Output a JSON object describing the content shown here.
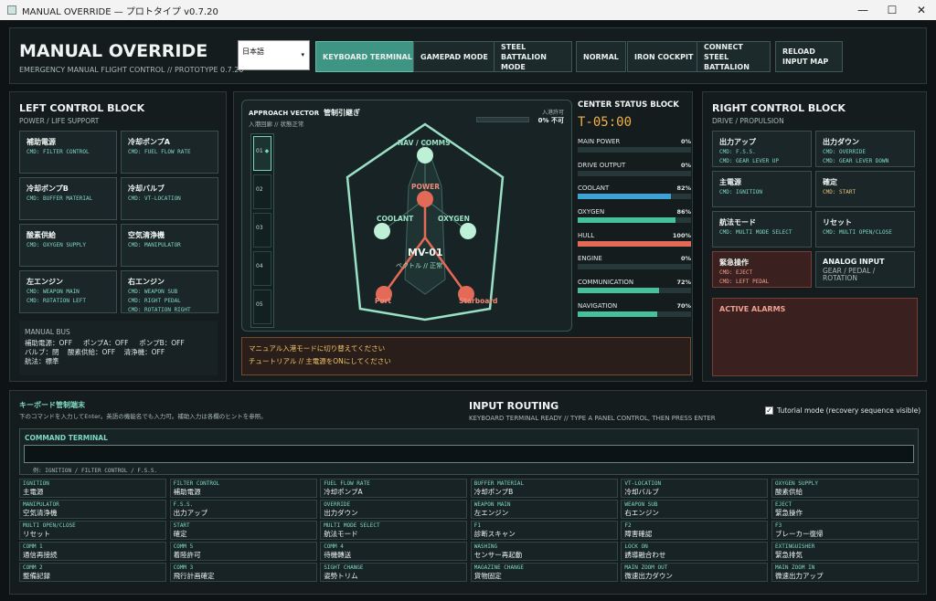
{
  "window": {
    "title": "MANUAL OVERRIDE — プロトタイプ v0.7.20",
    "minimize": "—",
    "maximize": "☐",
    "close": "✕"
  },
  "header": {
    "title": "MANUAL OVERRIDE",
    "subtitle": "EMERGENCY MANUAL FLIGHT CONTROL // PROTOTYPE 0.7.20",
    "language": "日本語",
    "modes": [
      "KEYBOARD TERMINAL",
      "GAMEPAD MODE",
      "STEEL BATTALION MODE",
      "NORMAL",
      "IRON COCKPIT",
      "CONNECT STEEL BATTALION",
      "RELOAD INPUT MAP"
    ],
    "active_mode": "KEYBOARD TERMINAL"
  },
  "left": {
    "title": "LEFT CONTROL BLOCK",
    "subtitle": "POWER / LIFE SUPPORT",
    "controls": [
      {
        "name": "補助電源",
        "cmd": [
          "CMD: FILTER CONTROL"
        ]
      },
      {
        "name": "冷却ポンプA",
        "cmd": [
          "CMD: FUEL FLOW RATE"
        ]
      },
      {
        "name": "冷却ポンプB",
        "cmd": [
          "CMD: BUFFER MATERIAL"
        ]
      },
      {
        "name": "冷却バルブ",
        "cmd": [
          "CMD: VT-LOCATION"
        ]
      },
      {
        "name": "酸素供給",
        "cmd": [
          "CMD: OXYGEN SUPPLY"
        ]
      },
      {
        "name": "空気清浄機",
        "cmd": [
          "CMD: MANIPULATOR"
        ]
      },
      {
        "name": "左エンジン",
        "cmd": [
          "CMD: WEAPON MAIN",
          "CMD: ROTATION LEFT"
        ]
      },
      {
        "name": "右エンジン",
        "cmd": [
          "CMD: WEAPON SUB",
          "CMD: RIGHT PEDAL",
          "CMD: ROTATION RIGHT"
        ]
      }
    ],
    "bus": {
      "title": "MANUAL BUS",
      "lines": [
        "補助電源：OFF     ポンプA：OFF     ポンプB：OFF",
        "バルブ：閉    酸素供給：OFF    清浄機：OFF",
        "航法：標準"
      ]
    }
  },
  "center": {
    "vector_title": "APPROACH VECTOR",
    "vector_title_jp": "管制引継ぎ",
    "vector_status": "入港回廊 // 状態正常",
    "permission_label": "入港許可",
    "permission_value": "0% 不可",
    "permission": 0,
    "slots": [
      "01",
      "02",
      "03",
      "04",
      "05"
    ],
    "nodes": {
      "nav": "NAV / COMMS",
      "power": "POWER",
      "coolant": "COOLANT",
      "oxygen": "OXYGEN",
      "port": "Port",
      "starboard": "Starboard"
    },
    "ship_id": "MV-01",
    "ship_state": "ベクトル // 正常",
    "messages": [
      "マニュアル入港モードに切り替えてください",
      "チュートリアル // 主電源をONにしてください"
    ]
  },
  "status": {
    "title": "CENTER STATUS BLOCK",
    "timer": "T-05:00",
    "rows": [
      {
        "label": "MAIN POWER",
        "value": "0%",
        "pct": 0,
        "color": "#46c29a"
      },
      {
        "label": "DRIVE OUTPUT",
        "value": "0%",
        "pct": 0,
        "color": "#46c29a"
      },
      {
        "label": "COOLANT",
        "value": "82%",
        "pct": 82,
        "color": "#3fa2d6"
      },
      {
        "label": "OXYGEN",
        "value": "86%",
        "pct": 86,
        "color": "#46c29a"
      },
      {
        "label": "HULL",
        "value": "100%",
        "pct": 100,
        "color": "#e46a58"
      },
      {
        "label": "ENGINE",
        "value": "0%",
        "pct": 0,
        "color": "#46c29a"
      },
      {
        "label": "COMMUNICATION",
        "value": "72%",
        "pct": 72,
        "color": "#46c29a"
      },
      {
        "label": "NAVIGATION",
        "value": "70%",
        "pct": 70,
        "color": "#46c29a"
      }
    ]
  },
  "right": {
    "title": "RIGHT CONTROL BLOCK",
    "subtitle": "DRIVE / PROPULSION",
    "controls": [
      {
        "name": "出力アップ",
        "cmd": [
          "CMD: F.S.S.",
          "CMD: GEAR LEVER UP"
        ]
      },
      {
        "name": "出力ダウン",
        "cmd": [
          "CMD: OVERRIDE",
          "CMD: GEAR LEVER DOWN"
        ]
      },
      {
        "name": "主電源",
        "cmd": [
          "CMD: IGNITION"
        ]
      },
      {
        "name": "確定",
        "cmd": [
          "CMD: START"
        ]
      },
      {
        "name": "航法モード",
        "cmd": [
          "CMD: MULTI MODE SELECT"
        ]
      },
      {
        "name": "リセット",
        "cmd": [
          "CMD: MULTI OPEN/CLOSE"
        ]
      },
      {
        "name": "緊急操作",
        "cmd": [
          "CMD: EJECT",
          "CMD: LEFT PEDAL"
        ]
      },
      {
        "name": "ANALOG INPUT",
        "cmd": [
          "GEAR / PEDAL / ROTATION"
        ]
      }
    ],
    "alarms": "ACTIVE ALARMS"
  },
  "bottom": {
    "kb_title": "キーボード管制端末",
    "kb_desc": "下のコマンドを入力してEnter。英語の機能名でも入力可。補助入力は各欄のヒントを参照。",
    "routing_title": "INPUT ROUTING",
    "routing_sub": "KEYBOARD TERMINAL READY // TYPE A PANEL CONTROL, THEN PRESS ENTER",
    "tutorial_label": "Tutorial mode (recovery sequence visible)",
    "tutorial_checked": true,
    "terminal_title": "COMMAND TERMINAL",
    "terminal_value": "",
    "terminal_example": "例: IGNITION / FILTER CONTROL / F.S.S.",
    "commands": [
      {
        "c": "IGNITION",
        "j": "主電源"
      },
      {
        "c": "FILTER CONTROL",
        "j": "補助電源"
      },
      {
        "c": "FUEL FLOW RATE",
        "j": "冷却ポンプA"
      },
      {
        "c": "BUFFER MATERIAL",
        "j": "冷却ポンプB"
      },
      {
        "c": "VT-LOCATION",
        "j": "冷却バルブ"
      },
      {
        "c": "OXYGEN SUPPLY",
        "j": "酸素供給"
      },
      {
        "c": "MANIPULATOR",
        "j": "空気清浄機"
      },
      {
        "c": "F.S.S.",
        "j": "出力アップ"
      },
      {
        "c": "OVERRIDE",
        "j": "出力ダウン"
      },
      {
        "c": "WEAPON MAIN",
        "j": "左エンジン"
      },
      {
        "c": "WEAPON SUB",
        "j": "右エンジン"
      },
      {
        "c": "EJECT",
        "j": "緊急操作"
      },
      {
        "c": "MULTI OPEN/CLOSE",
        "j": "リセット"
      },
      {
        "c": "START",
        "j": "確定"
      },
      {
        "c": "MULTI MODE SELECT",
        "j": "航法モード"
      },
      {
        "c": "F1",
        "j": "診断スキャン"
      },
      {
        "c": "F2",
        "j": "障害確認"
      },
      {
        "c": "F3",
        "j": "ブレーカー復帰"
      },
      {
        "c": "COMM 1",
        "j": "通信再接続"
      },
      {
        "c": "COMM 5",
        "j": "着陸許可"
      },
      {
        "c": "COMM 4",
        "j": "待機轉送"
      },
      {
        "c": "WASHING",
        "j": "センサー再起動"
      },
      {
        "c": "LOCK ON",
        "j": "誘導融合わせ"
      },
      {
        "c": "EXTINGUISHER",
        "j": "緊急排気"
      },
      {
        "c": "COMM 2",
        "j": "整備記録"
      },
      {
        "c": "COMM 3",
        "j": "飛行計画確定"
      },
      {
        "c": "SIGHT CHANGE",
        "j": "姿勢トリム"
      },
      {
        "c": "MAGAZINE CHANGE",
        "j": "貨物固定"
      },
      {
        "c": "MAIN ZOOM OUT",
        "j": "微速出力ダウン"
      },
      {
        "c": "MAIN ZOOM IN",
        "j": "微速出力アップ"
      }
    ]
  }
}
